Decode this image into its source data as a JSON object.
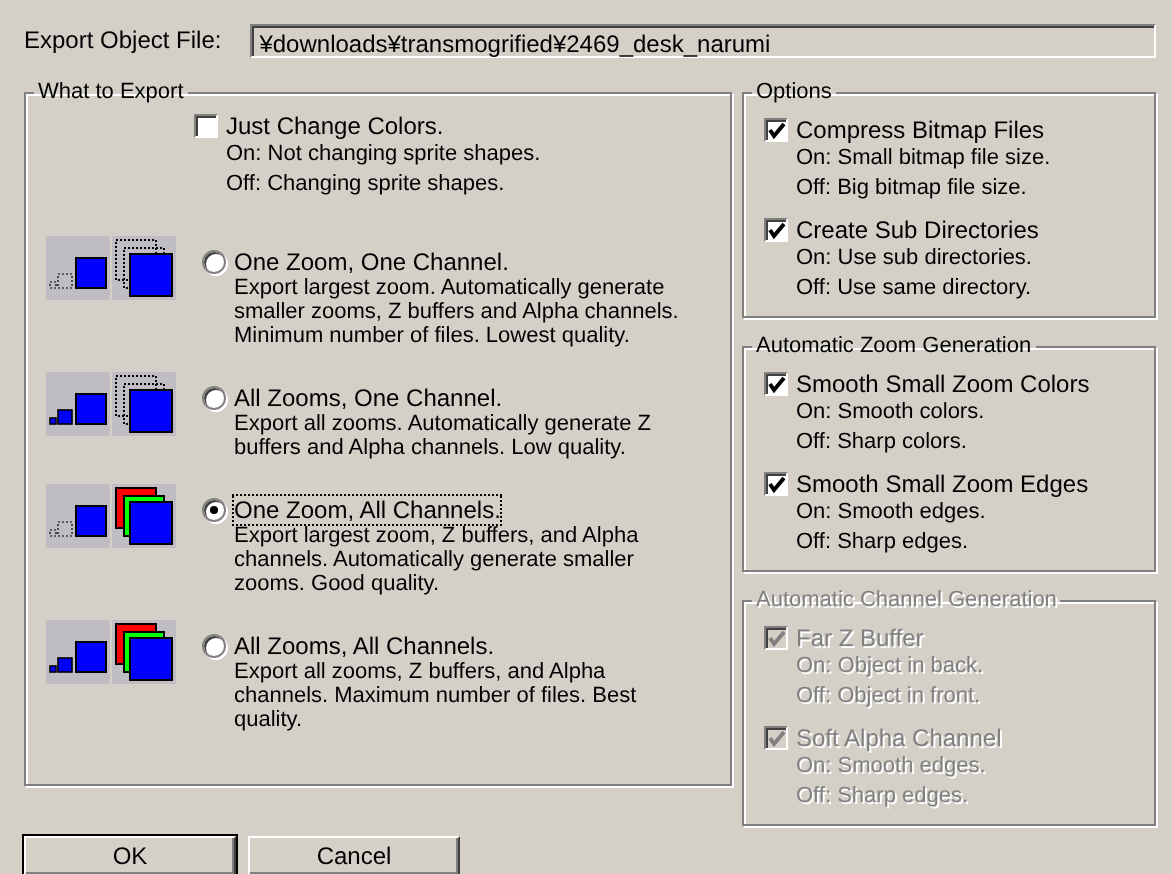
{
  "export_file": {
    "label": "Export Object File:",
    "value": "¥downloads¥transmogrified¥2469_desk_narumi"
  },
  "what_to_export": {
    "title": "What to Export",
    "items": [
      {
        "kind": "checkbox",
        "label": "Just Change Colors.",
        "checked": false,
        "lines": [
          "On: Not changing sprite shapes.",
          "Off: Changing sprite shapes."
        ]
      },
      {
        "kind": "radio",
        "label": "One Zoom, One Channel.",
        "selected": false,
        "focused": false,
        "description": "Export largest zoom. Automatically generate\nsmaller zooms, Z buffers and Alpha channels.\nMinimum number of files. Lowest quality."
      },
      {
        "kind": "radio",
        "label": "All Zooms, One Channel.",
        "selected": false,
        "focused": false,
        "description": "Export all zooms. Automatically generate Z\nbuffers and Alpha channels. Low quality."
      },
      {
        "kind": "radio",
        "label": "One Zoom, All Channels.",
        "selected": true,
        "focused": true,
        "description": "Export largest zoom, Z buffers, and Alpha\nchannels. Automatically generate smaller\nzooms. Good quality."
      },
      {
        "kind": "radio",
        "label": "All Zooms, All Channels.",
        "selected": false,
        "focused": false,
        "description": "Export all zooms, Z buffers, and Alpha\nchannels. Maximum number of files. Best\nquality."
      }
    ]
  },
  "groups": [
    {
      "title": "Options",
      "disabled": false,
      "items": [
        {
          "label": "Compress Bitmap Files",
          "checked": true,
          "lines": [
            "On: Small bitmap file size.",
            "Off: Big bitmap file size."
          ]
        },
        {
          "label": "Create Sub Directories",
          "checked": true,
          "lines": [
            "On: Use sub directories.",
            "Off: Use same directory."
          ]
        }
      ]
    },
    {
      "title": "Automatic Zoom Generation",
      "disabled": false,
      "items": [
        {
          "label": "Smooth Small Zoom Colors",
          "checked": true,
          "lines": [
            "On: Smooth colors.",
            "Off: Sharp colors."
          ]
        },
        {
          "label": "Smooth Small Zoom Edges",
          "checked": true,
          "lines": [
            "On: Smooth edges.",
            "Off: Sharp edges."
          ]
        }
      ]
    },
    {
      "title": "Automatic Channel Generation",
      "disabled": true,
      "items": [
        {
          "label": "Far Z Buffer",
          "checked": true,
          "lines": [
            "On: Object in back.",
            "Off: Object in front."
          ]
        },
        {
          "label": "Soft Alpha Channel",
          "checked": true,
          "lines": [
            "On: Smooth edges.",
            "Off: Sharp edges."
          ]
        }
      ]
    }
  ],
  "buttons": [
    {
      "label": "OK",
      "default": true
    },
    {
      "label": "Cancel",
      "default": false
    }
  ]
}
